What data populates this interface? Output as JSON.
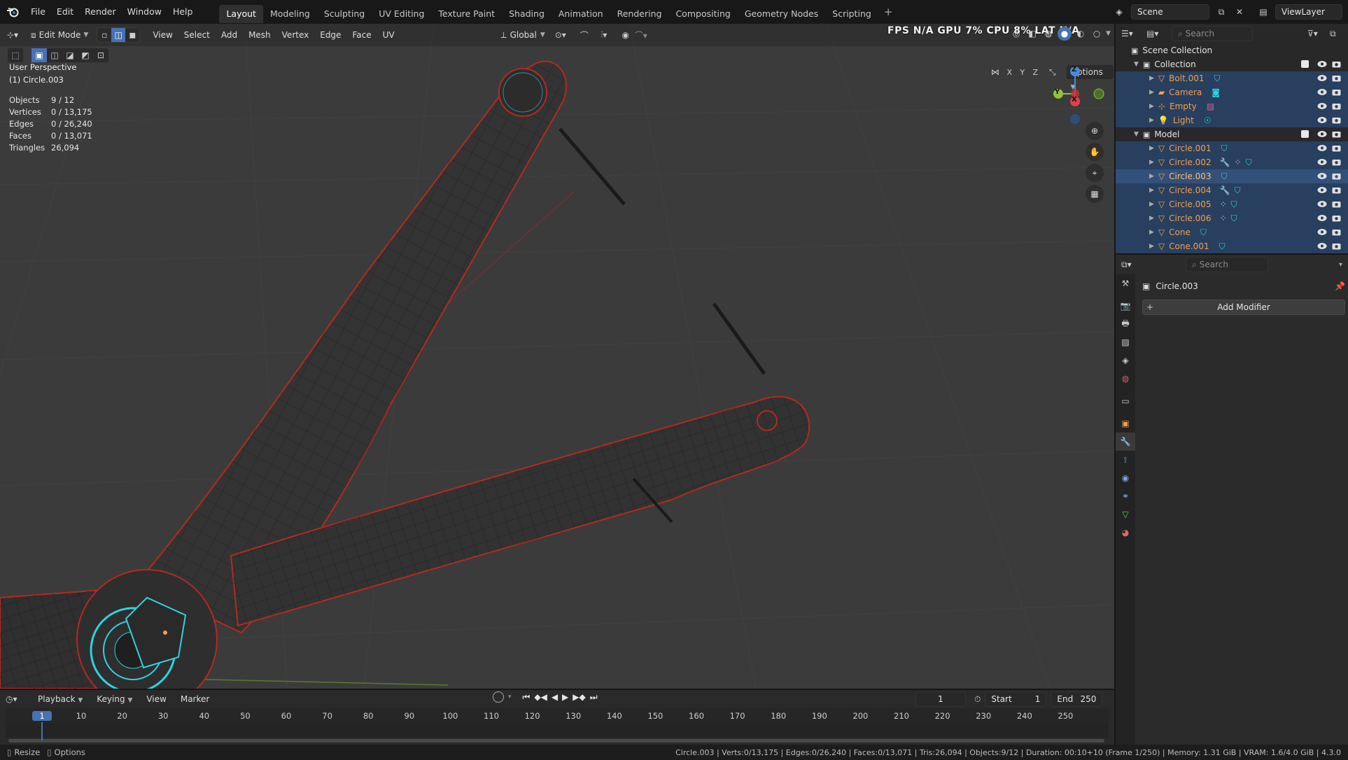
{
  "menubar": {
    "items": [
      "File",
      "Edit",
      "Render",
      "Window",
      "Help"
    ],
    "workspaces": [
      "Layout",
      "Modeling",
      "Sculpting",
      "UV Editing",
      "Texture Paint",
      "Shading",
      "Animation",
      "Rendering",
      "Compositing",
      "Geometry Nodes",
      "Scripting"
    ],
    "active_workspace": "Layout",
    "scene": "Scene",
    "view_layer": "ViewLayer"
  },
  "viewport": {
    "mode": "Edit Mode",
    "menus": [
      "View",
      "Select",
      "Add",
      "Mesh",
      "Vertex",
      "Edge",
      "Face",
      "UV"
    ],
    "transform_orientation": "Global",
    "options_label": "Options",
    "axis_buttons": [
      "X",
      "Y",
      "Z"
    ],
    "overlay_text": "FPS  N/A  GPU  7%  CPU  8%  LAT  N/A",
    "perspective_label": "User Perspective",
    "object_label": "(1) Circle.003",
    "stats": [
      {
        "label": "Objects",
        "value": "9 / 12"
      },
      {
        "label": "Vertices",
        "value": "0 / 13,175"
      },
      {
        "label": "Edges",
        "value": "0 / 26,240"
      },
      {
        "label": "Faces",
        "value": "0 / 13,071"
      },
      {
        "label": "Triangles",
        "value": "26,094"
      }
    ],
    "gizmo": {
      "x": "X",
      "y": "Y",
      "z": "Z"
    }
  },
  "outliner": {
    "search_placeholder": "Search",
    "scene_collection": "Scene Collection",
    "collections": [
      {
        "name": "Collection",
        "items": [
          "Bolt.001",
          "Camera",
          "Empty",
          "Light"
        ]
      },
      {
        "name": "Model",
        "items": [
          "Circle.001",
          "Circle.002",
          "Circle.003",
          "Circle.004",
          "Circle.005",
          "Circle.006",
          "Cone",
          "Cone.001"
        ]
      }
    ],
    "selected_item": "Circle.003"
  },
  "properties": {
    "search_placeholder": "Search",
    "object_name": "Circle.003",
    "add_modifier_label": "Add Modifier"
  },
  "timeline": {
    "menus": [
      "Playback",
      "Keying",
      "View",
      "Marker"
    ],
    "current_frame": "1",
    "start_label": "Start",
    "start_value": "1",
    "end_label": "End",
    "end_value": "250",
    "ruler_marks": [
      "1",
      "10",
      "20",
      "30",
      "40",
      "50",
      "60",
      "70",
      "80",
      "90",
      "100",
      "110",
      "120",
      "130",
      "140",
      "150",
      "160",
      "170",
      "180",
      "190",
      "200",
      "210",
      "220",
      "230",
      "240",
      "250"
    ]
  },
  "statusbar": {
    "left_items": [
      "Resize",
      "Options"
    ],
    "right_text": "Circle.003 | Verts:0/13,175 | Edges:0/26,240 | Faces:0/13,071 | Tris:26,094 | Objects:9/12 | Duration: 00:10+10 (Frame 1/250) | Memory: 1.31 GiB | VRAM: 1.6/4.0 GiB | 4.3.0"
  },
  "colors": {
    "accent_blue": "#4772b3",
    "selection_orange": "#f0a050",
    "outline_red": "#c8281e",
    "highlight_cyan": "#2fd2e0"
  }
}
